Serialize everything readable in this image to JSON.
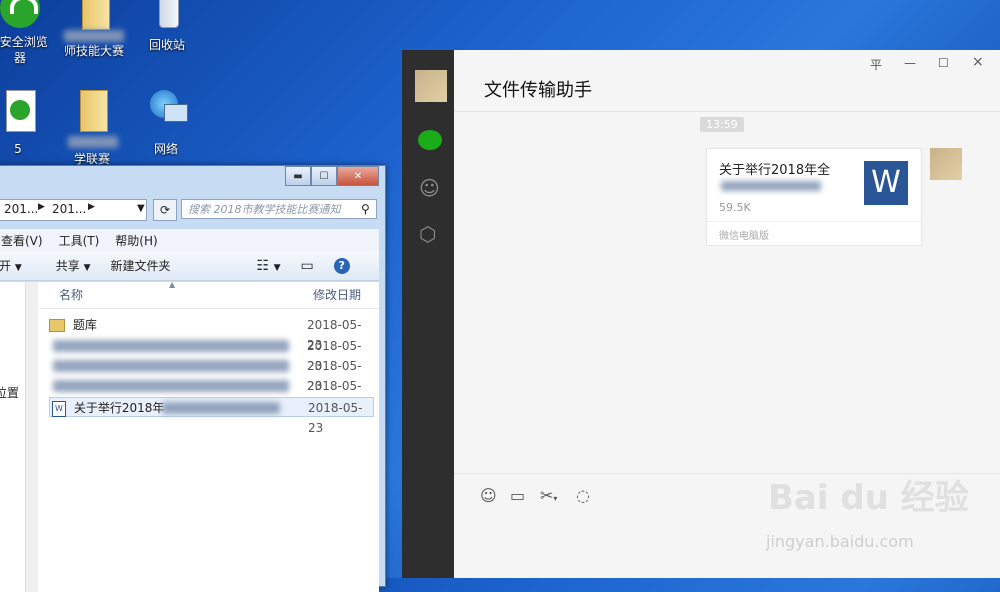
{
  "desktop": {
    "icons": [
      {
        "label": "0安全浏览\n器"
      },
      {
        "label": "师技能大赛"
      },
      {
        "label": "回收站"
      },
      {
        "label": "5"
      },
      {
        "label": "学联赛"
      },
      {
        "label": "网络"
      }
    ]
  },
  "explorer": {
    "crumbs": [
      "201...",
      "201..."
    ],
    "search_placeholder": "搜索 2018市教学技能比赛通知",
    "menu": [
      "查看(V)",
      "工具(T)",
      "帮助(H)"
    ],
    "toolbar": {
      "open": "开",
      "share": "共享",
      "new_folder": "新建文件夹"
    },
    "columns": {
      "name": "名称",
      "date": "修改日期"
    },
    "nav_label": "位置",
    "files": [
      {
        "name": "题库",
        "date": "2018-05-23"
      },
      {
        "name": "",
        "date": "2018-05-23"
      },
      {
        "name": "",
        "date": "2018-05-23"
      },
      {
        "name": "",
        "date": "2018-05-23"
      },
      {
        "name": "关于举行2018年",
        "date": "2018-05-23"
      }
    ]
  },
  "wechat": {
    "title": "文件传输助手",
    "controls": {
      "pin": "平",
      "minimize": "—",
      "maximize": "☐",
      "close": "×"
    },
    "time": "13:59",
    "file": {
      "name": "关于举行2018年全",
      "size": "59.5K",
      "source": "微信电脑版",
      "icon_letter": "W"
    }
  },
  "watermark": {
    "brand": "Bai du 经验",
    "url": "jingyan.baidu.com"
  }
}
